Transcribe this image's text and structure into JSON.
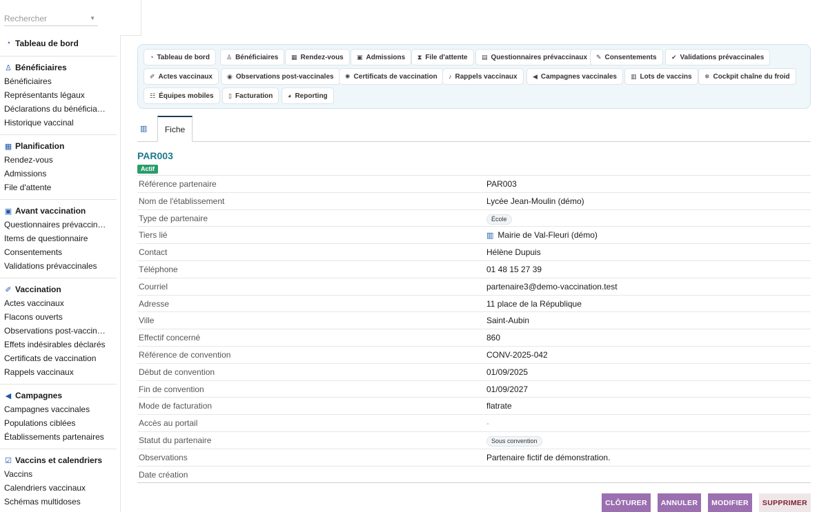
{
  "search": {
    "placeholder": "Rechercher"
  },
  "sidebar": {
    "dashboard": {
      "icon": "dashboard-icon",
      "label": "Tableau de bord"
    },
    "sections": [
      {
        "icon": "people-icon",
        "title": "Bénéficiaires",
        "items": [
          "Bénéficiaires",
          "Représentants légaux",
          "Déclarations du bénéficia…",
          "Historique vaccinal"
        ]
      },
      {
        "icon": "calendar-icon",
        "title": "Planification",
        "items": [
          "Rendez-vous",
          "Admissions",
          "File d'attente"
        ]
      },
      {
        "icon": "clipboard-icon",
        "title": "Avant vaccination",
        "items": [
          "Questionnaires prévaccin…",
          "Items de questionnaire",
          "Consentements",
          "Validations prévaccinales"
        ]
      },
      {
        "icon": "syringe-icon",
        "title": "Vaccination",
        "items": [
          "Actes vaccinaux",
          "Flacons ouverts",
          "Observations post-vaccin…",
          "Effets indésirables déclarés",
          "Certificats de vaccination",
          "Rappels vaccinaux"
        ]
      },
      {
        "icon": "megaphone-icon",
        "title": "Campagnes",
        "items": [
          "Campagnes vaccinales",
          "Populations ciblées",
          "Établissements partenaires"
        ]
      },
      {
        "icon": "calendar-check-icon",
        "title": "Vaccins et calendriers",
        "items": [
          "Vaccins",
          "Calendriers vaccinaux",
          "Schémas multidoses"
        ]
      }
    ]
  },
  "nav": {
    "chips": [
      {
        "icon": "dashboard-icon",
        "glyph": "◔",
        "label": "Tableau de bord"
      },
      {
        "icon": "people-icon",
        "glyph": "♙",
        "label": "Bénéficiaires"
      },
      {
        "icon": "calendar-icon",
        "glyph": "▦",
        "label": "Rendez-vous"
      },
      {
        "icon": "clipboard-icon",
        "glyph": "▣",
        "label": "Admissions"
      },
      {
        "icon": "hourglass-icon",
        "glyph": "⧗",
        "label": "File d'attente"
      },
      {
        "icon": "clipboard-icon",
        "glyph": "▤",
        "label": "Questionnaires prévaccinaux"
      },
      {
        "icon": "signature-icon",
        "glyph": "✎",
        "label": "Consentements"
      },
      {
        "icon": "user-check-icon",
        "glyph": "✔",
        "label": "Validations prévaccinales"
      },
      {
        "icon": "syringe-icon",
        "glyph": "✐",
        "label": "Actes vaccinaux"
      },
      {
        "icon": "eye-icon",
        "glyph": "◉",
        "label": "Observations post-vaccinales"
      },
      {
        "icon": "certificate-icon",
        "glyph": "✺",
        "label": "Certificats de vaccination"
      },
      {
        "icon": "bell-icon",
        "glyph": "♪",
        "label": "Rappels vaccinaux"
      },
      {
        "icon": "megaphone-icon",
        "glyph": "◀",
        "label": "Campagnes vaccinales"
      },
      {
        "icon": "barcode-icon",
        "glyph": "▥",
        "label": "Lots de vaccins"
      },
      {
        "icon": "snowflake-icon",
        "glyph": "❄",
        "label": "Cockpit chaîne du froid"
      },
      {
        "icon": "users-icon",
        "glyph": "☷",
        "label": "Équipes mobiles"
      },
      {
        "icon": "invoice-icon",
        "glyph": "▯",
        "label": "Facturation"
      },
      {
        "icon": "pie-chart-icon",
        "glyph": "◕",
        "label": "Reporting"
      }
    ]
  },
  "tabs": {
    "fiche": "Fiche"
  },
  "record": {
    "title": "PAR003",
    "status": "Actif",
    "fields": [
      {
        "label": "Référence partenaire",
        "value": "PAR003"
      },
      {
        "label": "Nom de l'établissement",
        "value": "Lycée Jean-Moulin (démo)"
      },
      {
        "label": "Type de partenaire",
        "value": "École",
        "kind": "pill"
      },
      {
        "label": "Tiers lié",
        "value": "Mairie de Val-Fleuri (démo)",
        "kind": "link"
      },
      {
        "label": "Contact",
        "value": "Hélène Dupuis"
      },
      {
        "label": "Téléphone",
        "value": "01 48 15 27 39"
      },
      {
        "label": "Courriel",
        "value": "partenaire3@demo-vaccination.test"
      },
      {
        "label": "Adresse",
        "value": "11 place de la République"
      },
      {
        "label": "Ville",
        "value": "Saint-Aubin"
      },
      {
        "label": "Effectif concerné",
        "value": "860"
      },
      {
        "label": "Référence de convention",
        "value": "CONV-2025-042"
      },
      {
        "label": "Début de convention",
        "value": "01/09/2025"
      },
      {
        "label": "Fin de convention",
        "value": "01/09/2027"
      },
      {
        "label": "Mode de facturation",
        "value": "flatrate"
      },
      {
        "label": "Accès au portail",
        "value": "-",
        "kind": "dash"
      },
      {
        "label": "Statut du partenaire",
        "value": "Sous convention",
        "kind": "pill"
      },
      {
        "label": "Observations",
        "value": "Partenaire fictif de démonstration."
      },
      {
        "label": "Date création",
        "value": ""
      }
    ]
  },
  "actions": {
    "close": "CLÔTURER",
    "cancel": "ANNULER",
    "edit": "MODIFIER",
    "delete": "SUPPRIMER"
  },
  "colors": {
    "accent": "#9b6fb0",
    "title": "#1a7a8a",
    "status_active": "#2a9d6a",
    "icon_blue": "#1e5aa8"
  }
}
